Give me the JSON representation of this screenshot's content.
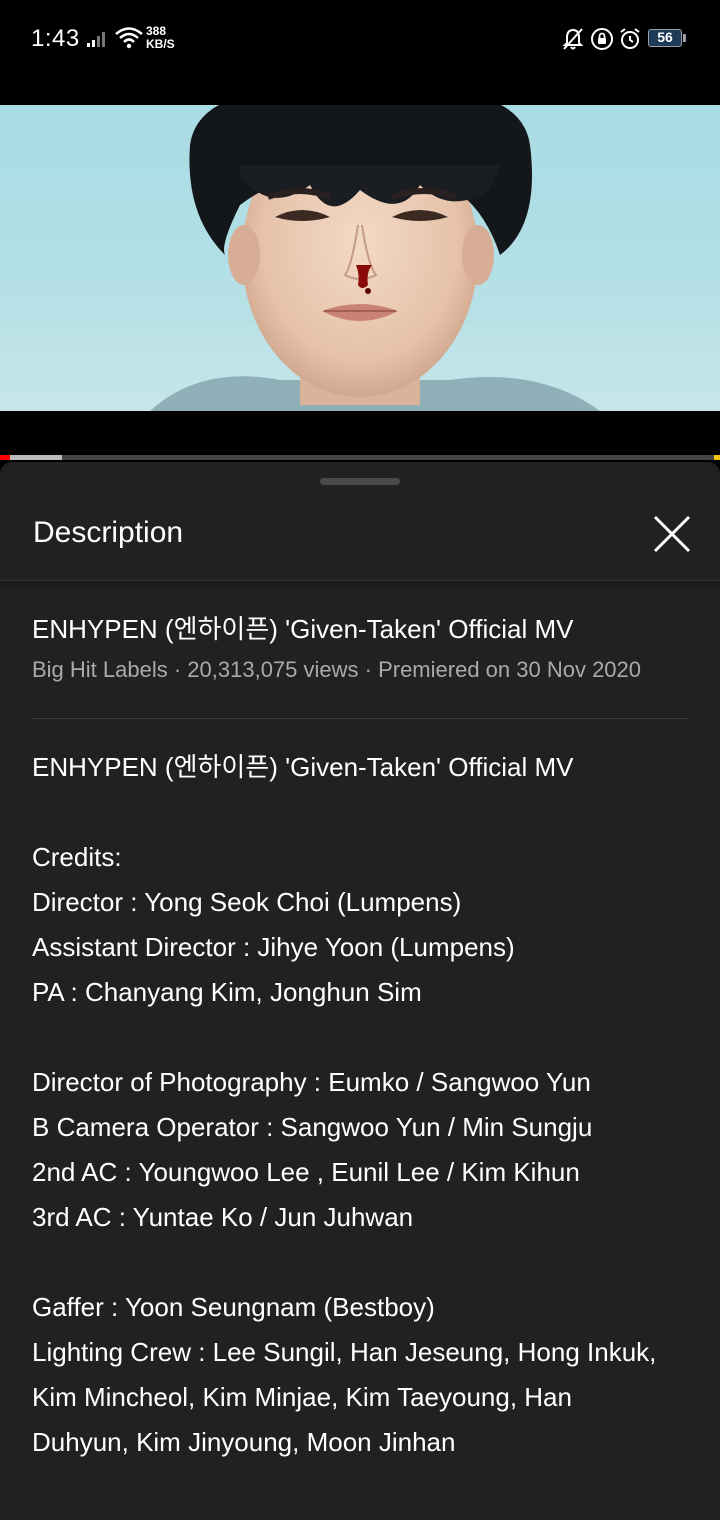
{
  "status_bar": {
    "time": "1:43",
    "net_speed_value": "388",
    "net_speed_unit": "KB/S",
    "battery_level": "56",
    "icons": [
      "signal-icon",
      "wifi-icon",
      "bell-off-icon",
      "rotation-lock-icon",
      "alarm-icon",
      "battery-icon"
    ]
  },
  "player": {
    "progress_played": 0.014,
    "progress_buffered": 0.086,
    "colors": {
      "played": "#ff0000",
      "buffer": "#bbbbbb",
      "track": "#444444"
    }
  },
  "sheet": {
    "title": "Description",
    "close_icon": "close-icon"
  },
  "video": {
    "title": "ENHYPEN (엔하이픈) 'Given-Taken' Official MV",
    "meta": "Big Hit Labels · 20,313,075 views · Premiered on 30 Nov 2020"
  },
  "description": {
    "lines": [
      "ENHYPEN (엔하이픈) 'Given-Taken' Official MV",
      "",
      "Credits:",
      "Director : Yong Seok Choi (Lumpens)",
      "Assistant Director : Jihye Yoon (Lumpens)",
      "PA : Chanyang Kim, Jonghun Sim",
      "",
      "Director of Photography : Eumko / Sangwoo Yun",
      "B Camera Operator : Sangwoo Yun / Min Sungju",
      "2nd AC : Youngwoo Lee , Eunil Lee / Kim Kihun",
      "3rd AC : Yuntae Ko / Jun Juhwan",
      "",
      "Gaffer : Yoon Seungnam (Bestboy)",
      "Lighting Crew : Lee Sungil, Han Jeseung, Hong Inkuk,",
      "Kim Mincheol, Kim Minjae, Kim Taeyoung, Han",
      "Duhyun, Kim Jinyoung, Moon Jinhan"
    ]
  }
}
